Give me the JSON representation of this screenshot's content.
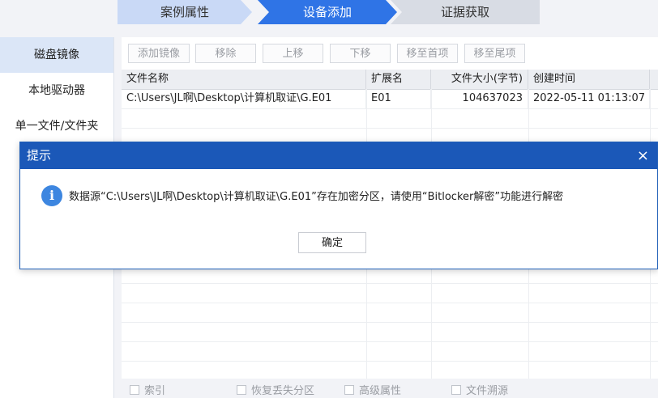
{
  "steps": [
    "案例属性",
    "设备添加",
    "证据获取"
  ],
  "sidebar": {
    "items": [
      {
        "label": "磁盘镜像"
      },
      {
        "label": "本地驱动器"
      },
      {
        "label": "单一文件/文件夹"
      }
    ]
  },
  "toolbar": {
    "add": "添加镜像",
    "remove": "移除",
    "up": "上移",
    "down": "下移",
    "top": "移至首项",
    "bottom": "移至尾项"
  },
  "table": {
    "columns": [
      "文件名称",
      "扩展名",
      "文件大小(字节)",
      "创建时间"
    ],
    "rows": [
      [
        "C:\\Users\\JL啊\\Desktop\\计算机取证\\G.E01",
        "E01",
        "104637023",
        "2022-05-11 01:13:07"
      ]
    ]
  },
  "options": [
    "索引",
    "恢复丢失分区",
    "高级属性",
    "文件溯源"
  ],
  "dialog": {
    "title": "提示",
    "close": "×",
    "icon": "info-icon",
    "message": "数据源“C:\\Users\\JL啊\\Desktop\\计算机取证\\G.E01”存在加密分区，请使用“Bitlocker解密”功能进行解密",
    "ok": "确定"
  },
  "colors": {
    "accent": "#2f74e6",
    "dialog_title": "#1b58b8",
    "info": "#3d86e0"
  }
}
